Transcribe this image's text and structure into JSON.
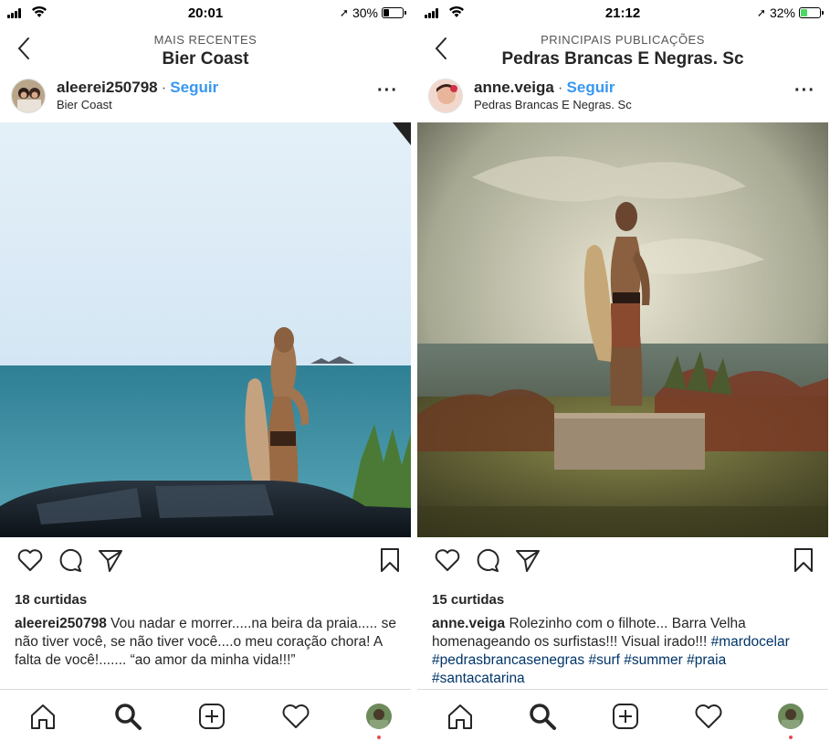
{
  "left": {
    "status": {
      "time": "20:01",
      "battery": "30%"
    },
    "nav": {
      "subtitle": "MAIS RECENTES",
      "title": "Bier Coast"
    },
    "post": {
      "username": "aleerei250798",
      "separator": "·",
      "follow": "Seguir",
      "location": "Bier Coast",
      "more": "···",
      "likes": "18 curtidas",
      "caption_user": "aleerei250798",
      "caption_text": "Vou nadar e morrer.....na beira da praia..... se não tiver você, se não tiver você....o meu coração chora! A falta de você!....... “ao amor da minha vida!!!”",
      "hashtags": ""
    }
  },
  "right": {
    "status": {
      "time": "21:12",
      "battery": "32%"
    },
    "nav": {
      "subtitle": "PRINCIPAIS PUBLICAÇÕES",
      "title": "Pedras Brancas E Negras. Sc"
    },
    "post": {
      "username": "anne.veiga",
      "separator": "·",
      "follow": "Seguir",
      "location": "Pedras Brancas E Negras. Sc",
      "more": "···",
      "likes": "15 curtidas",
      "caption_user": "anne.veiga",
      "caption_text": "Rolezinho com o filhote... Barra Velha homenageando os surfistas!!! Visual irado!!!",
      "hashtags": "#mardocelar #pedrasbrancasenegras #surf #summer #praia #santacatarina"
    }
  },
  "icons": {
    "signal": "signal-icon",
    "wifi": "wifi-icon",
    "location": "location-arrow-icon",
    "battery": "battery-icon",
    "back": "chevron-left-icon",
    "like": "heart-icon",
    "comment": "comment-icon",
    "share": "paper-plane-icon",
    "save": "bookmark-icon",
    "home": "home-icon",
    "search": "search-icon",
    "add": "plus-square-icon",
    "activity": "heart-icon",
    "profile": "profile-avatar"
  },
  "colors": {
    "link": "#3897f0",
    "hashtag": "#003569",
    "notification": "#ed4956",
    "battery_low": "#000000",
    "battery_charging": "#4cd964"
  }
}
